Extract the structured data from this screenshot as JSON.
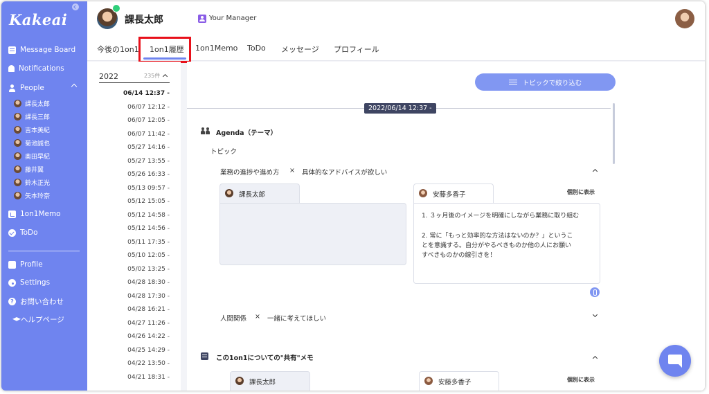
{
  "app": {
    "logo": "Kakeai"
  },
  "sidebar": {
    "items": [
      {
        "label": "Message Board",
        "icon": "board-icon"
      },
      {
        "label": "Notifications",
        "icon": "bell-icon"
      },
      {
        "label": "People",
        "icon": "person-icon"
      },
      {
        "label": "1on1Memo",
        "icon": "memo-icon"
      },
      {
        "label": "ToDo",
        "icon": "check-icon"
      },
      {
        "label": "Profile",
        "icon": "profile-icon"
      },
      {
        "label": "Settings",
        "icon": "gear-icon"
      },
      {
        "label": "お問い合わせ",
        "icon": "help-icon"
      },
      {
        "label": "ヘルプページ",
        "icon": "graduation-cap-icon"
      }
    ],
    "people": [
      "課長太郎",
      "課長三郎",
      "吉本美紀",
      "菊池誠也",
      "奥田早紀",
      "藤井翼",
      "鈴木正光",
      "矢本玲奈"
    ]
  },
  "header": {
    "user_name": "課長太郎",
    "role_label": "Your Manager",
    "tabs": [
      "今後の1on1",
      "1on1履歴",
      "1on1Memo",
      "ToDo",
      "メッセージ",
      "プロフィール"
    ],
    "active_tab": "1on1履歴"
  },
  "history": {
    "year": "2022",
    "count": "235件",
    "dates": [
      "06/14 12:37 -",
      "06/07 12:12 -",
      "06/07 12:05 -",
      "06/07 11:42 -",
      "05/27 14:16 -",
      "05/27 13:55 -",
      "05/26 16:33 -",
      "05/13 09:57 -",
      "05/12 15:05 -",
      "05/12 14:58 -",
      "05/12 14:56 -",
      "05/11 17:35 -",
      "05/10 12:05 -",
      "05/02 13:25 -",
      "04/28 18:30 -",
      "04/28 17:30 -",
      "04/28 16:21 -",
      "04/27 11:26 -",
      "04/26 14:22 -",
      "04/25 14:29 -",
      "04/22 13:50 -",
      "04/21 18:31 -"
    ]
  },
  "main": {
    "filter_button": "トピックで絞り込む",
    "session_date": "2022/06/14 12:37 -",
    "agenda_title": "Agenda（テーマ）",
    "topic_label": "トピック",
    "topic1": {
      "name": "業務の進捗や進め方",
      "separator": "×",
      "request": "具体的なアドバイスが欲しい"
    },
    "topic2": {
      "name": "人間関係",
      "separator": "×",
      "request": "一緒に考えてほしい"
    },
    "manager_name": "課長太郎",
    "member_name": "安藤多香子",
    "show_each_label": "個別に表示",
    "member_memo": [
      "1. ３ヶ月後のイメージを明確にしながら業務に取り組む",
      "",
      "2. 常に「もっと効率的な方法はないのか？」というこ",
      "とを意識する。自分がやるべきものか他の人にお願い",
      "すべきものかの線引きを！"
    ],
    "shared_memo_title": "この1on1についての\"共有\"メモ"
  },
  "colors": {
    "sidebar": "#6f84ef",
    "accent": "#8197f2",
    "highlight": "#e8101a",
    "date_pill": "#3e4562"
  }
}
